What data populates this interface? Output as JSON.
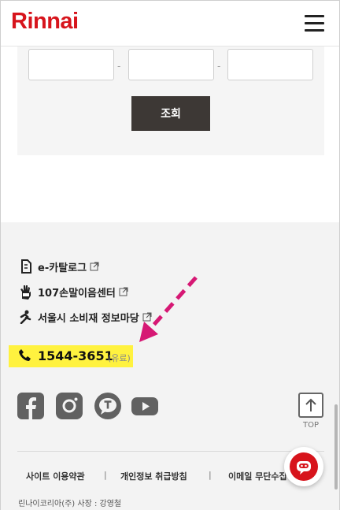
{
  "header": {
    "logo": "Rinnai"
  },
  "lookup": {
    "field_separator": "-",
    "search_label": "조회"
  },
  "footer": {
    "links": [
      {
        "label": "e-카탈로그",
        "icon": "catalog-icon"
      },
      {
        "label": "107손말이음센터",
        "icon": "sign-language-icon"
      },
      {
        "label": "서울시 소비재 정보마당",
        "icon": "info-figure-icon"
      }
    ],
    "phone": {
      "number": "1544-3651",
      "note": "(유료)"
    },
    "social": [
      "facebook-icon",
      "instagram-icon",
      "talk-icon",
      "youtube-icon"
    ],
    "top_label": "TOP",
    "policies": [
      "사이트 이용약관",
      "개인정보 취급방침",
      "이메일 무단수집"
    ],
    "policy_separator": "|",
    "company": "린나이코리아(주) 사장 : 강영철"
  },
  "colors": {
    "brand": "#d7141c",
    "highlight": "#fff23f",
    "annotation_arrow": "#d61874",
    "button_dark": "#3d3835"
  }
}
